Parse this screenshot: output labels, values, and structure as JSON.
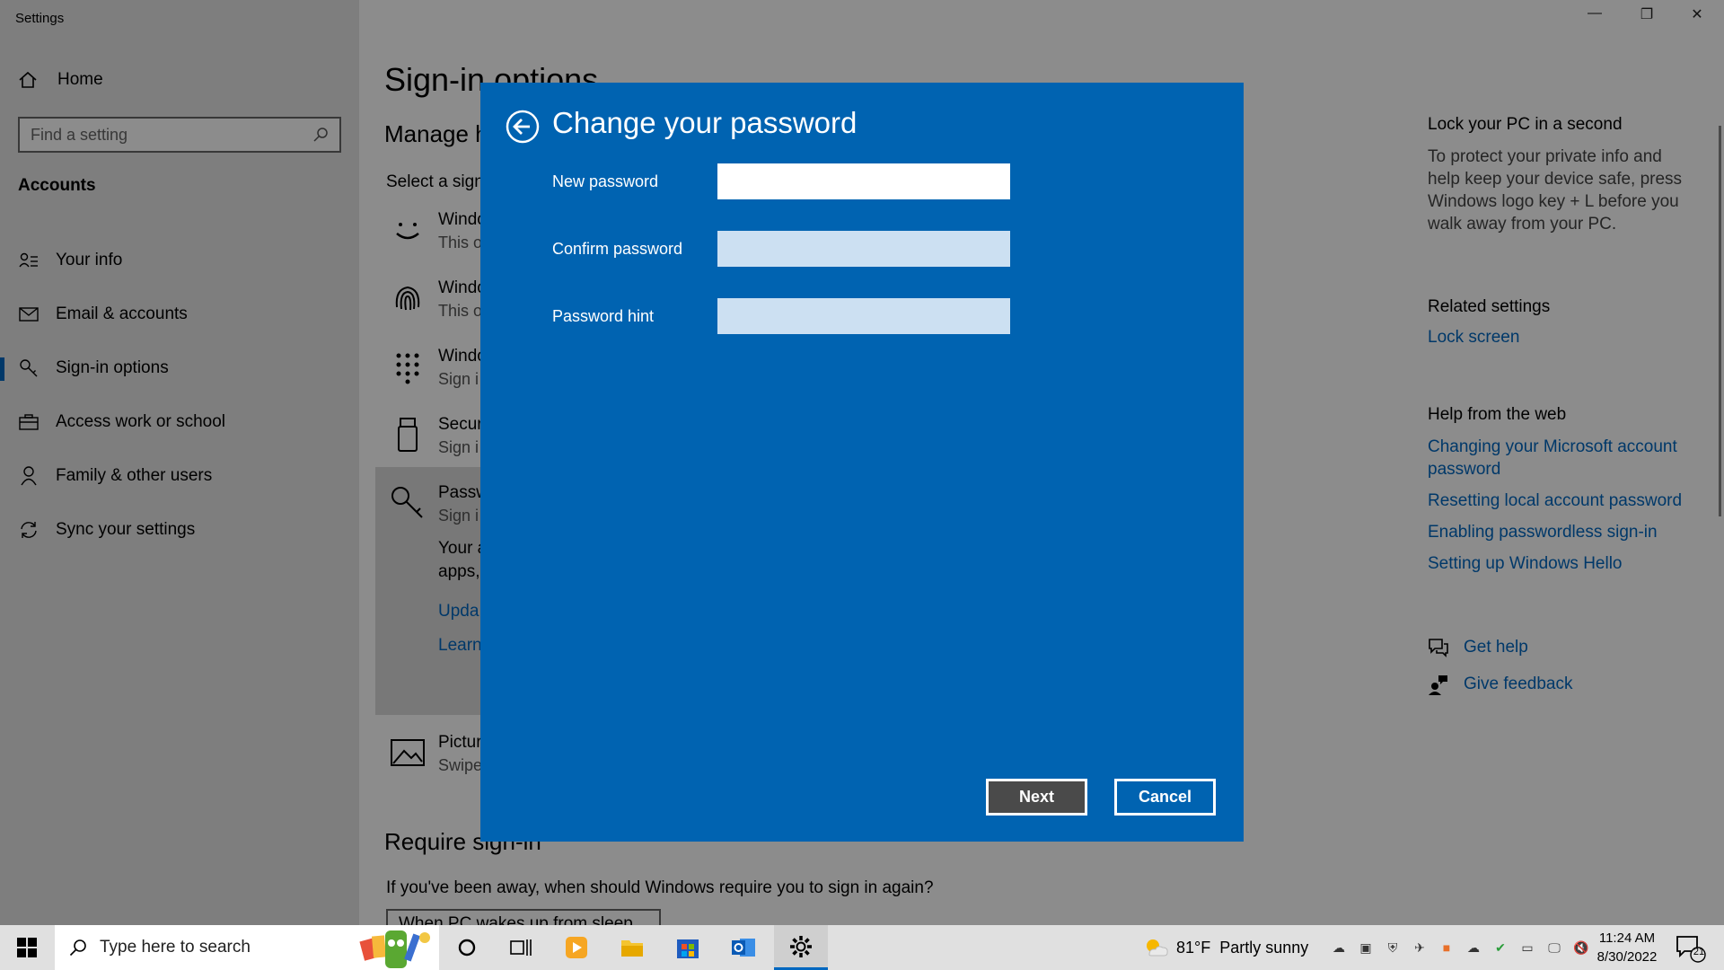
{
  "window": {
    "title": "Settings",
    "minimize": "—",
    "restore": "❐",
    "close": "✕"
  },
  "sidebar": {
    "home": "Home",
    "search_placeholder": "Find a setting",
    "heading": "Accounts",
    "items": [
      {
        "label": "Your info",
        "icon": "person-list-icon"
      },
      {
        "label": "Email & accounts",
        "icon": "mail-icon"
      },
      {
        "label": "Sign-in options",
        "icon": "key-icon"
      },
      {
        "label": "Access work or school",
        "icon": "briefcase-icon"
      },
      {
        "label": "Family & other users",
        "icon": "person-icon"
      },
      {
        "label": "Sync your settings",
        "icon": "sync-icon"
      }
    ]
  },
  "main": {
    "title": "Sign-in options",
    "subtitle": "Manage h",
    "select_text": "Select a sign",
    "options": [
      {
        "title": "Windo",
        "sub": "This o"
      },
      {
        "title": "Windo",
        "sub": "This o"
      },
      {
        "title": "Windo",
        "sub": "Sign i"
      },
      {
        "title": "Secur",
        "sub": "Sign i"
      },
      {
        "title": "Passw",
        "sub": "Sign i"
      },
      {
        "title": "Pictur",
        "sub": "Swipe"
      }
    ],
    "password_para_1": "Your a",
    "password_para_2": "apps,",
    "link_update": "Upda",
    "link_learn": "Learn",
    "require_title": "Require sign-in",
    "require_text": "If you've been away, when should Windows require you to sign in again?",
    "require_select": "When PC wakes up from sleep"
  },
  "right": {
    "lock_title": "Lock your PC in a second",
    "lock_text": "To protect your private info and help keep your device safe, press Windows logo key + L before you walk away from your PC.",
    "related_title": "Related settings",
    "related_link": "Lock screen",
    "help_title": "Help from the web",
    "help_links": [
      "Changing your Microsoft account password",
      "Resetting local account password",
      "Enabling passwordless sign-in",
      "Setting up Windows Hello"
    ],
    "get_help": "Get help",
    "give_feedback": "Give feedback"
  },
  "dialog": {
    "title": "Change your password",
    "new_password_label": "New password",
    "new_password_value": "",
    "confirm_password_label": "Confirm password",
    "confirm_password_value": "",
    "hint_label": "Password hint",
    "hint_value": "",
    "next_label": "Next",
    "cancel_label": "Cancel"
  },
  "taskbar": {
    "search_placeholder": "Type here to search",
    "weather_temp": "81°F",
    "weather_text": "Partly sunny",
    "time": "11:24 AM",
    "date": "8/30/2022",
    "notification_count": "21"
  },
  "colors": {
    "dialog_bg": "#0063b1",
    "accent": "#0067c0",
    "next_button_bg": "#4a4a4a"
  }
}
